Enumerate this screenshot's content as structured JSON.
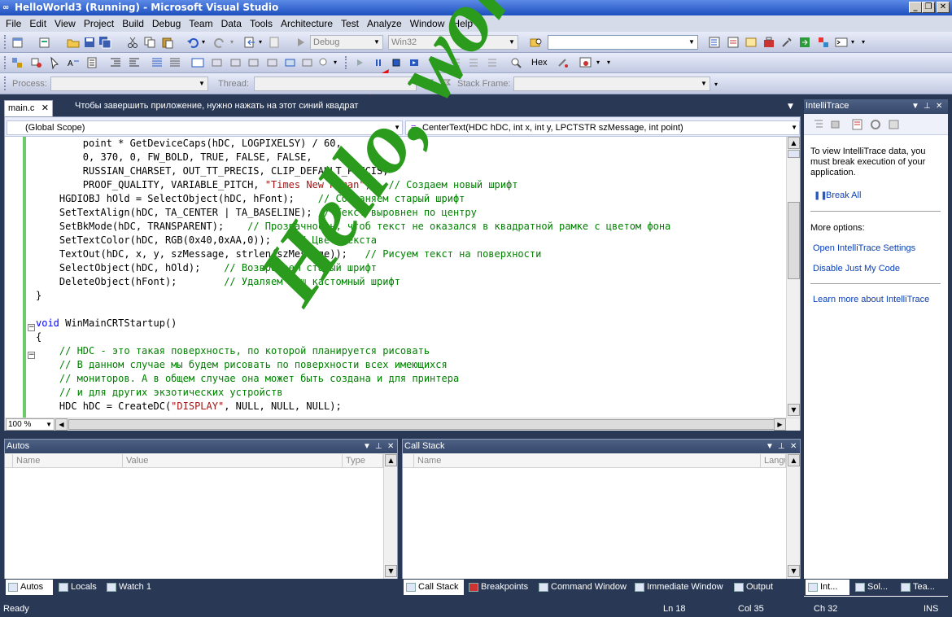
{
  "window": {
    "title": "HelloWorld3 (Running) - Microsoft Visual Studio",
    "controls": {
      "minimize": "_",
      "restore": "❐",
      "close": "✕"
    }
  },
  "menu": [
    "File",
    "Edit",
    "View",
    "Project",
    "Build",
    "Debug",
    "Team",
    "Data",
    "Tools",
    "Architecture",
    "Test",
    "Analyze",
    "Window",
    "Help"
  ],
  "toolbar1": {
    "config_combo": "Debug",
    "platform_combo": "Win32",
    "find_combo": ""
  },
  "toolbar2": {
    "hex_label": "Hex"
  },
  "toolbar3": {
    "process_label": "Process:",
    "thread_label": "Thread:",
    "stackframe_label": "Stack Frame:"
  },
  "editor": {
    "tab_label": "main.c",
    "tab_close": "✕",
    "hint_text": "Чтобы завершить приложение, нужно нажать на этот синий квадрат",
    "scope_combo": "(Global Scope)",
    "member_combo": "CenterText(HDC hDC, int x, int y, LPCTSTR szMessage, int point)",
    "zoom": "100 %",
    "code_lines": [
      {
        "segments": [
          {
            "t": "        point * GetDeviceCaps(hDC, LOGPIXELSY) / 60,",
            "c": ""
          }
        ]
      },
      {
        "segments": [
          {
            "t": "        0, 370, 0, FW_BOLD, TRUE, FALSE, FALSE,",
            "c": ""
          }
        ]
      },
      {
        "segments": [
          {
            "t": "        RUSSIAN_CHARSET, OUT_TT_PRECIS, CLIP_DEFAULT_PRECIS,",
            "c": ""
          }
        ]
      },
      {
        "segments": [
          {
            "t": "        PROOF_QUALITY, VARIABLE_PITCH, ",
            "c": ""
          },
          {
            "t": "\"Times New Roman\"",
            "c": "st"
          },
          {
            "t": ");  ",
            "c": ""
          },
          {
            "t": "// Создаем новый шрифт",
            "c": "cm"
          }
        ]
      },
      {
        "segments": [
          {
            "t": "    HGDIOBJ hOld = SelectObject(hDC, hFont);    ",
            "c": ""
          },
          {
            "t": "// Сохраняем старый шрифт",
            "c": "cm"
          }
        ]
      },
      {
        "segments": [
          {
            "t": "    SetTextAlign(hDC, TA_CENTER | TA_BASELINE); ",
            "c": ""
          },
          {
            "t": "// Текст выровнен по центру",
            "c": "cm"
          }
        ]
      },
      {
        "segments": [
          {
            "t": "    SetBkMode(hDC, TRANSPARENT);    ",
            "c": ""
          },
          {
            "t": "// Прозрачность, чтоб текст не оказался в квадратной рамке с цветом фона",
            "c": "cm"
          }
        ]
      },
      {
        "segments": [
          {
            "t": "    SetTextColor(hDC, RGB(0x40,0xAA,0));    ",
            "c": ""
          },
          {
            "t": "// Цвет текста",
            "c": "cm"
          }
        ]
      },
      {
        "segments": [
          {
            "t": "    TextOut(hDC, x, y, szMessage, strlen(szMessage));   ",
            "c": ""
          },
          {
            "t": "// Рисуем текст на поверхности",
            "c": "cm"
          }
        ]
      },
      {
        "segments": [
          {
            "t": "    SelectObject(hDC, hOld);    ",
            "c": ""
          },
          {
            "t": "// Возвращаем старый шрифт",
            "c": "cm"
          }
        ]
      },
      {
        "segments": [
          {
            "t": "    DeleteObject(hFont);        ",
            "c": ""
          },
          {
            "t": "// Удаляем наш кастомный шрифт",
            "c": "cm"
          }
        ]
      },
      {
        "segments": [
          {
            "t": "}",
            "c": ""
          }
        ]
      },
      {
        "segments": [
          {
            "t": "",
            "c": ""
          }
        ]
      },
      {
        "segments": [
          {
            "t": "void",
            "c": "kw"
          },
          {
            "t": " WinMainCRTStartup()",
            "c": ""
          }
        ]
      },
      {
        "segments": [
          {
            "t": "{",
            "c": ""
          }
        ]
      },
      {
        "segments": [
          {
            "t": "    ",
            "c": ""
          },
          {
            "t": "// HDC - это такая поверхность, по которой планируется рисовать",
            "c": "cm"
          }
        ]
      },
      {
        "segments": [
          {
            "t": "    ",
            "c": ""
          },
          {
            "t": "// В данном случае мы будем рисовать по поверхности всех имеющихся",
            "c": "cm"
          }
        ]
      },
      {
        "segments": [
          {
            "t": "    ",
            "c": ""
          },
          {
            "t": "// мониторов. А в общем случае она может быть создана и для принтера",
            "c": "cm"
          }
        ]
      },
      {
        "segments": [
          {
            "t": "    ",
            "c": ""
          },
          {
            "t": "// и для других экзотических устройств",
            "c": "cm"
          }
        ]
      },
      {
        "segments": [
          {
            "t": "    HDC hDC = CreateDC(",
            "c": ""
          },
          {
            "t": "\"DISPLAY\"",
            "c": "st"
          },
          {
            "t": ", NULL, NULL, NULL);",
            "c": ""
          }
        ]
      }
    ],
    "watermark": "Hello, world!"
  },
  "autos": {
    "title": "Autos",
    "columns": [
      "Name",
      "Value",
      "Type"
    ],
    "tabs": [
      "Autos",
      "Locals",
      "Watch 1"
    ]
  },
  "callstack": {
    "title": "Call Stack",
    "columns": [
      "Name",
      "Langu"
    ],
    "tabs": [
      "Call Stack",
      "Breakpoints",
      "Command Window",
      "Immediate Window",
      "Output"
    ]
  },
  "intellitrace": {
    "title": "IntelliTrace",
    "intro": "To view IntelliTrace data, you must break execution of your application.",
    "break_all": "Break All",
    "more_options": "More options:",
    "open_settings": "Open IntelliTrace Settings",
    "disable_jmc": "Disable Just My Code",
    "learn_more": "Learn more about IntelliTrace",
    "tabs": [
      "Int...",
      "Sol...",
      "Tea..."
    ]
  },
  "status": {
    "ready": "Ready",
    "line": "Ln 18",
    "col": "Col 35",
    "ch": "Ch 32",
    "mode": "INS"
  },
  "colors": {
    "accent_dark": "#293955",
    "watermark_green": "#2b9b1e",
    "comment": "#008000",
    "keyword": "#0000ff",
    "string": "#a31515"
  }
}
